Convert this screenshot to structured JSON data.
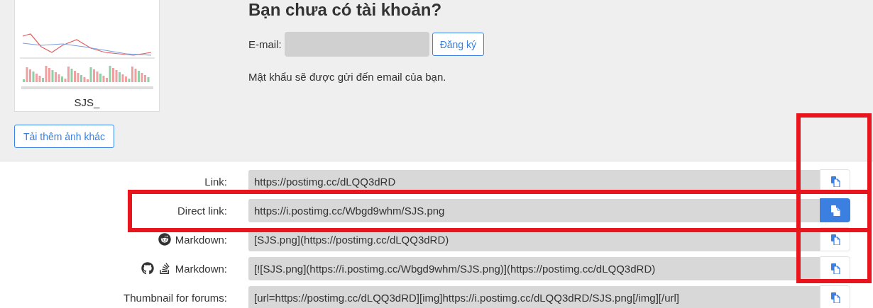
{
  "thumbnail": {
    "kind": "picture",
    "caption": "SJS_"
  },
  "upload_more_button": "Tải thêm ảnh khác",
  "signup": {
    "title": "Bạn chưa có tài khoản?",
    "email_label": "E-mail:",
    "button": "Đăng ký",
    "note": "Mật khẩu sẽ được gửi đến email của bạn."
  },
  "links": [
    {
      "kind": "plain",
      "label": "Link:",
      "value": "https://postimg.cc/dLQQ3dRD",
      "selected": false
    },
    {
      "kind": "plain",
      "label": "Direct link:",
      "value": "https://i.postimg.cc/Wbgd9whm/SJS.png",
      "selected": true
    },
    {
      "kind": "reddit",
      "label": "Markdown:",
      "value": "[SJS.png](https://postimg.cc/dLQQ3dRD)",
      "selected": false
    },
    {
      "kind": "github",
      "label": "Markdown:",
      "value": "[![SJS.png](https://i.postimg.cc/Wbgd9whm/SJS.png)](https://postimg.cc/dLQQ3dRD)",
      "selected": false
    },
    {
      "kind": "plain",
      "label": "Thumbnail for forums:",
      "value": "[url=https://postimg.cc/dLQQ3dRD][img]https://i.postimg.cc/dLQQ3dRD/SJS.png[/img][/url]",
      "selected": false
    }
  ]
}
